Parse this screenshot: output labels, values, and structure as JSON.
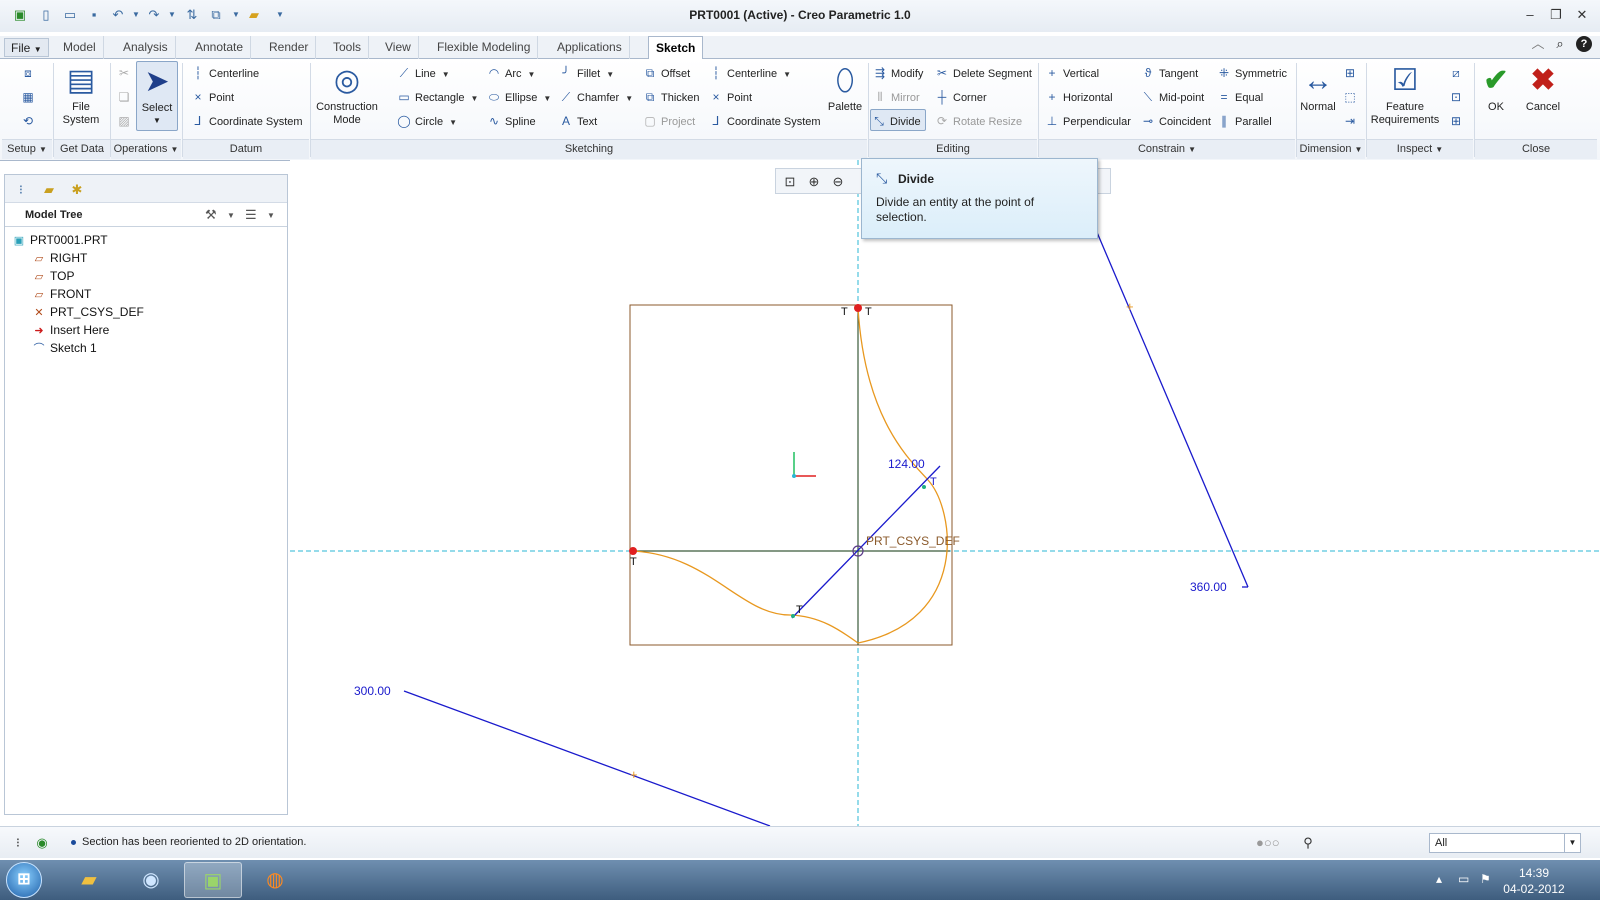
{
  "window": {
    "title": "PRT0001 (Active) - Creo Parametric 1.0"
  },
  "tabs": [
    "Model",
    "Analysis",
    "Annotate",
    "Render",
    "Tools",
    "View",
    "Flexible Modeling",
    "Applications",
    "Sketch"
  ],
  "file_tab": "File",
  "ribbon": {
    "groups": [
      "Setup",
      "Get Data",
      "Operations",
      "Datum",
      "Sketching",
      "Editing",
      "Constrain",
      "Dimension",
      "Inspect",
      "Close"
    ],
    "file_system": "File\nSystem",
    "select": "Select",
    "datum": [
      "Centerline",
      "Point",
      "Coordinate System"
    ],
    "construction_mode": "Construction\nMode",
    "sketching_col1": [
      "Line",
      "Rectangle",
      "Circle"
    ],
    "sketching_col2": [
      "Arc",
      "Ellipse",
      "Spline"
    ],
    "sketching_col3": [
      "Fillet",
      "Chamfer",
      "Text"
    ],
    "sketching_col4": [
      "Offset",
      "Thicken",
      "Project"
    ],
    "sketching_col5": [
      "Centerline",
      "Point",
      "Coordinate System"
    ],
    "palette": "Palette",
    "editing_col1": [
      "Modify",
      "Mirror",
      "Divide"
    ],
    "editing_col2": [
      "Delete Segment",
      "Corner",
      "Rotate Resize"
    ],
    "constrain_col1": [
      "Vertical",
      "Horizontal",
      "Perpendicular"
    ],
    "constrain_col2": [
      "Tangent",
      "Mid-point",
      "Coincident"
    ],
    "constrain_col3": [
      "Symmetric",
      "Equal",
      "Parallel"
    ],
    "normal": "Normal",
    "feature_requirements": "Feature\nRequirements",
    "ok": "OK",
    "cancel": "Cancel"
  },
  "model_tree": {
    "title": "Model Tree",
    "items": [
      "PRT0001.PRT",
      "RIGHT",
      "TOP",
      "FRONT",
      "PRT_CSYS_DEF",
      "Insert Here",
      "Sketch 1"
    ]
  },
  "tooltip": {
    "title": "Divide",
    "description": "Divide an entity at the point of selection."
  },
  "sketch": {
    "dim_124": "124.00",
    "dim_360": "360.00",
    "dim_300": "300.00",
    "csys_label": "PRT_CSYS_DEF",
    "t": "T"
  },
  "status": {
    "message": "Section has been reoriented to 2D orientation.",
    "filter": "All"
  },
  "taskbar": {
    "time": "14:39",
    "date": "04-02-2012"
  },
  "colors": {
    "sketch_blue": "#1a1acc",
    "sketch_orange": "#e8981f",
    "box_brown": "#8b5a2b",
    "axis_cyan": "#2bb7d6"
  }
}
